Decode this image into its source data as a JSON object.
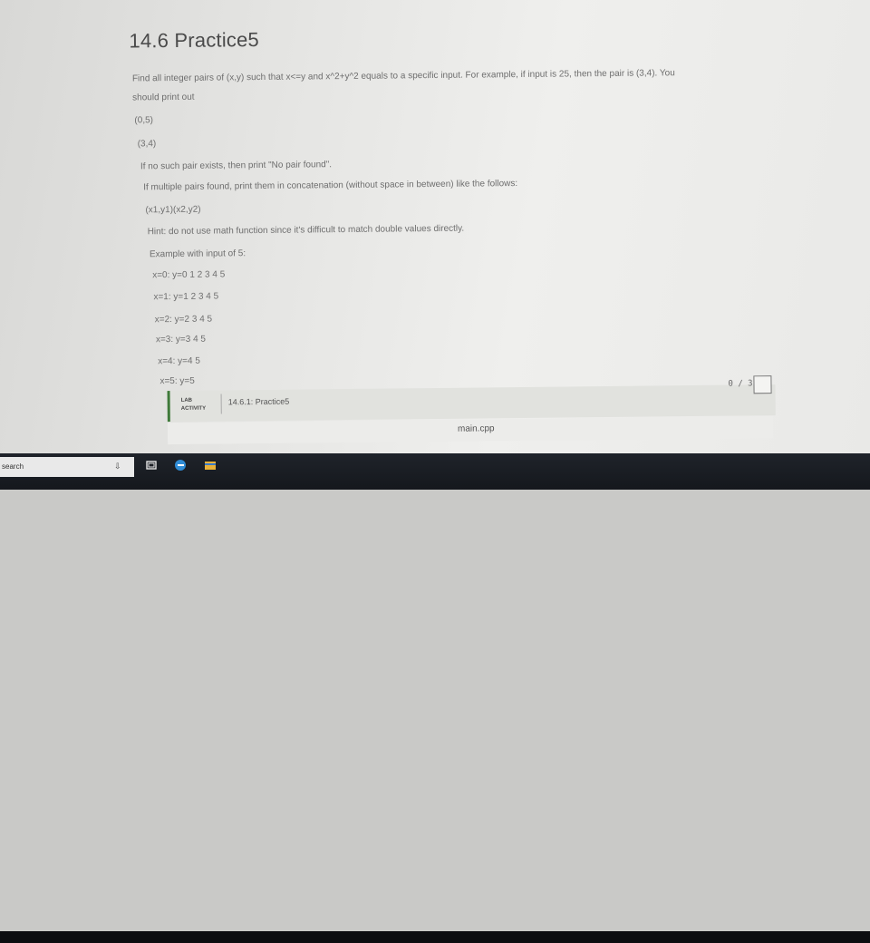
{
  "page": {
    "title": "14.6 Practice5",
    "paragraph_line1": "Find all integer pairs of (x,y) such that x<=y and x^2+y^2 equals to a specific input. For example, if input is 25, then the pair is (3,4). You",
    "paragraph_line2": "should print out",
    "pair1": "(0,5)",
    "pair2": "(3,4)",
    "no_pair": "If no such pair exists, then print \"No pair found\".",
    "multiple": "If multiple pairs found, print them in concatenation (without space in between) like the follows:",
    "format": "(x1,y1)(x2,y2)",
    "hint": "Hint: do not use math function since it's difficult to match double values directly.",
    "example_intro": "Example with input of 5:",
    "example_lines": [
      "x=0: y=0 1 2 3 4 5",
      "x=1: y=1 2 3 4 5",
      "x=2: y=2 3 4 5",
      "x=3: y=3 4 5",
      "x=4: y=4 5",
      "x=5: y=5"
    ]
  },
  "lab": {
    "tag_line1": "LAB",
    "tag_line2": "ACTIVITY",
    "name": "14.6.1: Practice5",
    "score": "0 / 3",
    "file": "main.cpp"
  },
  "taskbar": {
    "search_label": "search",
    "mic_glyph": "⇩",
    "icons": [
      "task-view-icon",
      "edge-browser-icon",
      "file-explorer-icon"
    ]
  },
  "colors": {
    "lab_accent": "#3f7a3a",
    "taskbar": "#1a1d23"
  }
}
